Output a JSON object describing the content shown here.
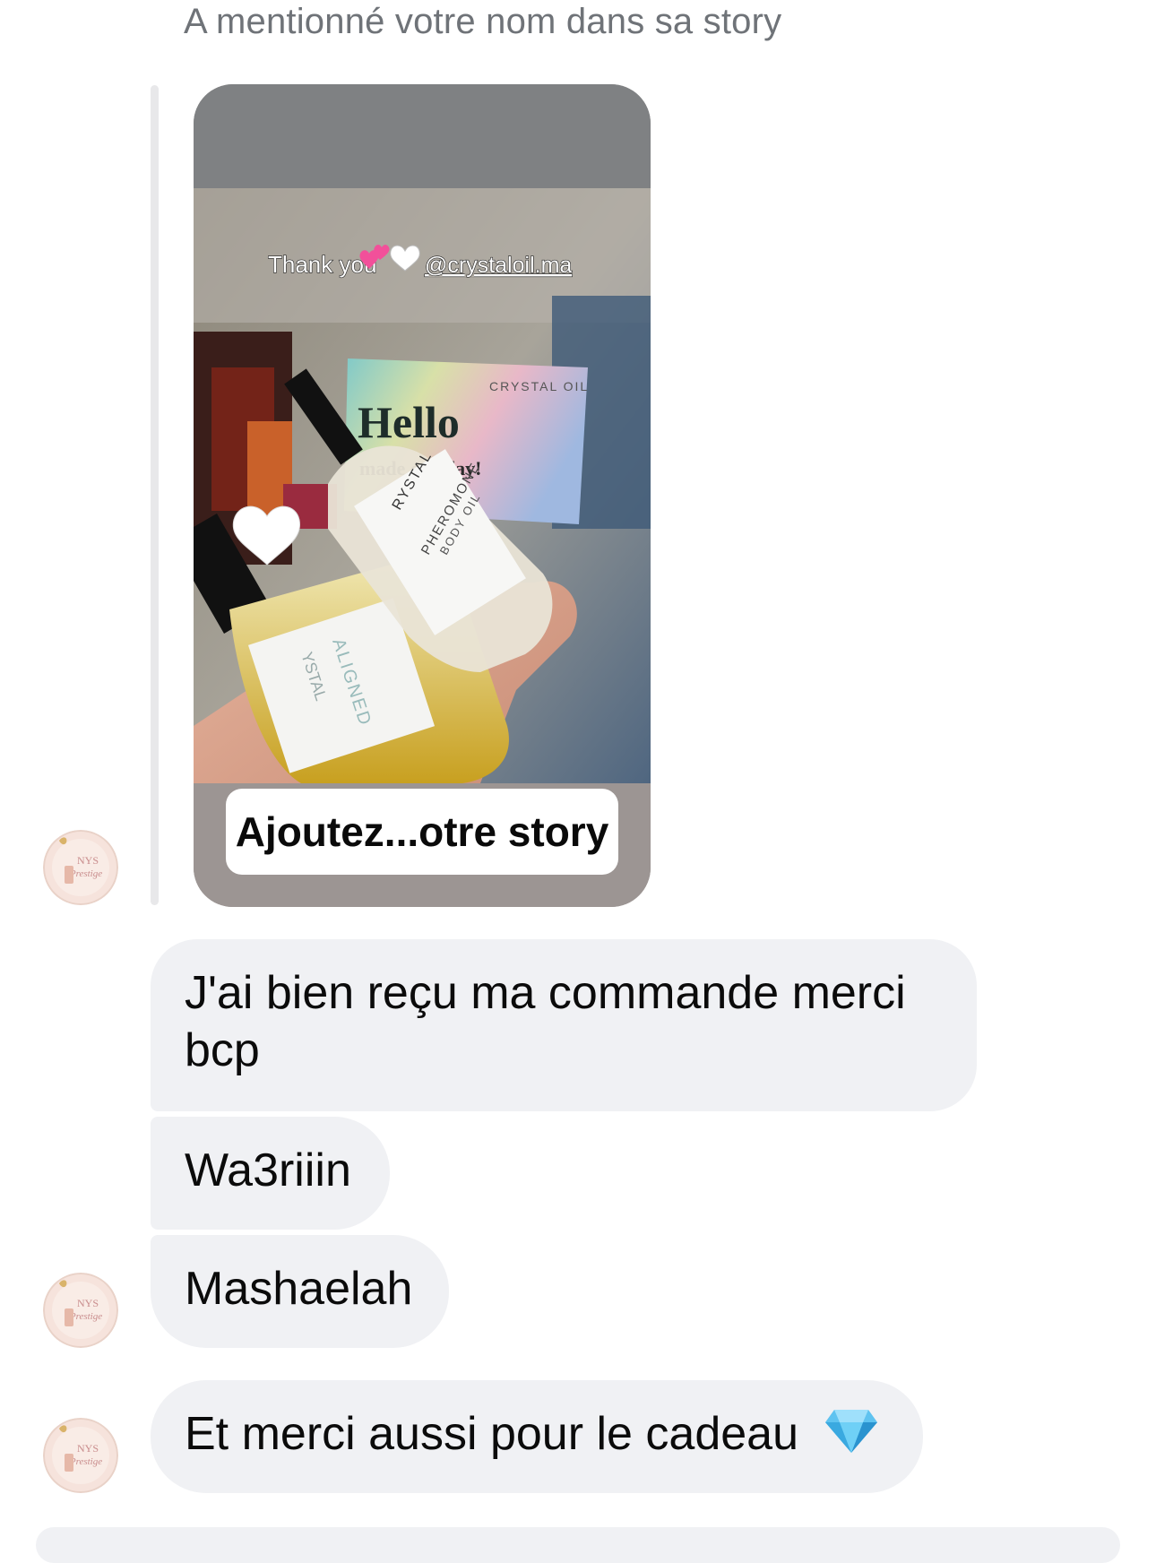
{
  "conversation": {
    "story_mention_note": "A mentionné votre nom dans sa story",
    "story": {
      "caption_text": "Thank you",
      "mention_handle": "@crystaloil.ma",
      "card_brand": "CRYSTAL OIL",
      "card_greeting": "Hello",
      "card_tagline": "made our day!",
      "bottle_front_brand": "RYSTAL",
      "bottle_front_name": "PHEROMONE",
      "bottle_front_type": "BODY OIL",
      "bottle_back_brand": "YSTAL",
      "bottle_back_name": "ALIGNED",
      "add_story_label": "Ajoutez...otre story"
    },
    "messages": [
      {
        "line1": "J'ai bien reçu ma commande merci",
        "line2": "bcp"
      },
      {
        "line1": "Wa3riiin"
      },
      {
        "line1": "Mashaelah"
      },
      {
        "line1": "Et merci aussi pour le cadeau",
        "emoji": "gem-icon"
      }
    ],
    "avatar_text": {
      "line1": "NYS",
      "line2": "Prestige"
    }
  },
  "colors": {
    "bubble_bg": "#f0f1f4",
    "muted_text": "#6f7378",
    "story_top": "#7f8183",
    "story_bottom": "#9c9593"
  }
}
